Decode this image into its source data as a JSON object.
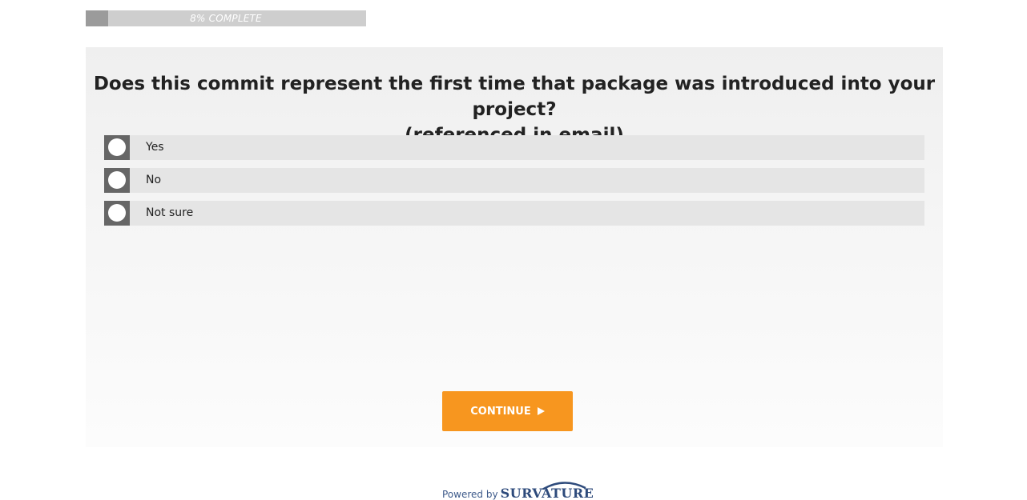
{
  "progress": {
    "label": "8% COMPLETE",
    "percent": 8
  },
  "question": {
    "line1": "Does this commit represent the first time that package was introduced into your project?",
    "line2": "(referenced in email)"
  },
  "options": [
    {
      "label": "Yes"
    },
    {
      "label": "No"
    },
    {
      "label": "Not sure"
    }
  ],
  "continue_button": {
    "label": "CONTINUE",
    "icon": "play-icon",
    "color": "#f7961f"
  },
  "footer": {
    "powered_by": "Powered by",
    "brand": "SURVATURE"
  }
}
